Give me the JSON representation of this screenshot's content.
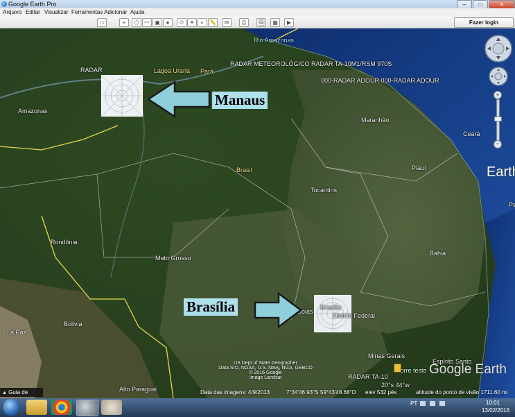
{
  "window": {
    "title": "Google Earth Pro",
    "minimize_label": "–",
    "maximize_label": "□",
    "close_label": "✕"
  },
  "menu": {
    "items": [
      "Arquivo",
      "Editar",
      "Visualizar",
      "Ferramentas",
      "Adicionar",
      "Ajuda"
    ]
  },
  "toolbar": {
    "login_label": "Fazer login"
  },
  "map": {
    "labels": {
      "rio_amazonas": "Rio Amazonas",
      "radar_top_left": "RADAR",
      "lagoa_uraria": "Lagoa Uraria",
      "para": "Pará",
      "radar_meteorologico": "RADAR METEOROLÓGICO  RADAR TA-10M1/RSM 970S",
      "radar_adour": "000-RADAR ADOUR  000-RADAR ADOUR",
      "amazonas": "Amazonas",
      "maranhao": "Maranhão",
      "ceara": "Ceará",
      "brasil": "Brasil",
      "piaui": "Piauí",
      "tocantins": "Tocantins",
      "rondonia": "Rondônia",
      "mato_grosso": "Mato Grosso",
      "bahia": "Bahia",
      "goias": "Goiás",
      "brasilia_label": "Brasília",
      "distrito_federal": "Distrito Federal",
      "bolivia": "Bolivia",
      "la_paz": "La Paz",
      "minas_gerais": "Minas Gerais",
      "espirito_santo": "Espírito Santo",
      "radar_ta10": "RADAR TA-10",
      "torre_teste": "torre teste",
      "coords_small": "20°s 44°w",
      "alto_paraguai": "Alto Paraguai",
      "earth_right": "Earth",
      "pe": "Pe"
    },
    "callouts": {
      "manaus": "Manaus",
      "brasilia": "Brasília"
    },
    "attribution": [
      "US Dept of State Geographer",
      "Data SIO, NOAA, U.S. Navy, NGA, GEBCO",
      "© 2016 Google",
      "Image Landsat"
    ],
    "watermark": "Google Earth"
  },
  "status": {
    "imagery_date": "Data das imagens: 4/9/2013",
    "lat": "7°34'46.93\"S",
    "lon": "59°43'48.68\"O",
    "elev": "elev  532 pés",
    "eye_alt": "altitude do ponto de visão 1711.60 mi"
  },
  "sidebar_tab": {
    "label": "Guia de turismo"
  },
  "taskbar": {
    "lang": "PT",
    "time": "10:01",
    "date": "13/02/2016"
  },
  "colors": {
    "callout_bg": "#aee0ec",
    "arrow_fill": "#8fcfdc",
    "border_yellow": "#e6d84a"
  }
}
